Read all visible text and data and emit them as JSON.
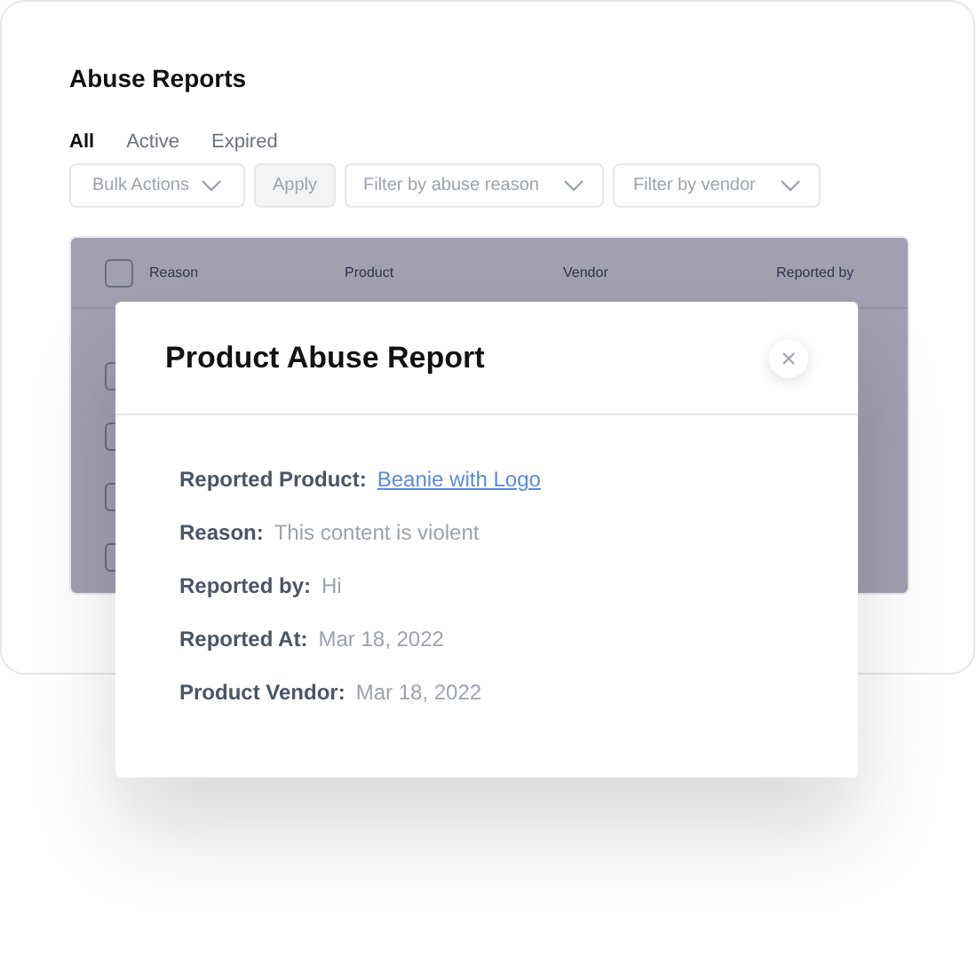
{
  "page": {
    "title": "Abuse Reports"
  },
  "tabs": [
    {
      "label": "All",
      "selected": true
    },
    {
      "label": "Active",
      "selected": false
    },
    {
      "label": "Expired",
      "selected": false
    }
  ],
  "toolbar": {
    "bulk_actions": "Bulk Actions",
    "apply": "Apply",
    "filters": [
      "Filter by abuse reason",
      "Filter by vendor"
    ]
  },
  "table": {
    "columns": [
      "Reason",
      "Product",
      "Vendor",
      "Reported by"
    ],
    "header_checked": false,
    "rows": [
      {
        "checked": false
      },
      {
        "checked": false
      },
      {
        "checked": false
      },
      {
        "checked": false
      }
    ]
  },
  "modal": {
    "title": "Product Abuse Report",
    "fields": [
      {
        "label": "Reported Product:",
        "value": "Beanie with Logo",
        "kind": "link"
      },
      {
        "label": "Reason:",
        "value": "This content is violent",
        "kind": "text"
      },
      {
        "label": "Reported by:",
        "value": "Hi",
        "kind": "text"
      },
      {
        "label": "Reported At:",
        "value": "Mar 18, 2022",
        "kind": "text"
      },
      {
        "label": "Product Vendor:",
        "value": "Mar 18, 2022",
        "kind": "text"
      }
    ]
  }
}
